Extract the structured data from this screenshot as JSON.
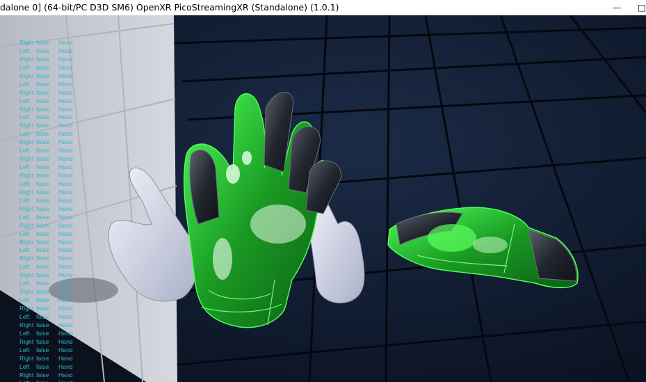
{
  "window": {
    "title": "dalone 0]  (64-bit/PC D3D SM6) OpenXR  PicoStreamingXR (Standalone) (1.0.1)",
    "minimize_glyph": "—",
    "maximize_glyph": "□"
  },
  "debug_log": [
    [
      "Right",
      "false",
      "Hand"
    ],
    [
      "Left",
      "false",
      "Hand"
    ],
    [
      "Right",
      "false",
      "Hand"
    ],
    [
      "Left",
      "false",
      "Hand"
    ],
    [
      "Right",
      "false",
      "Hand"
    ],
    [
      "Left",
      "false",
      "Hand"
    ],
    [
      "Right",
      "false",
      "Hand"
    ],
    [
      "Left",
      "false",
      "Hand"
    ],
    [
      "Right",
      "false",
      "Hand"
    ],
    [
      "Left",
      "false",
      "Hand"
    ],
    [
      "Right",
      "false",
      "Hand"
    ],
    [
      "Left",
      "false",
      "Hand"
    ],
    [
      "Right",
      "false",
      "Hand"
    ],
    [
      "Left",
      "false",
      "Hand"
    ],
    [
      "Right",
      "false",
      "Hand"
    ],
    [
      "Left",
      "false",
      "Hand"
    ],
    [
      "Right",
      "false",
      "Hand"
    ],
    [
      "Left",
      "false",
      "Hand"
    ],
    [
      "Right",
      "false",
      "Hand"
    ],
    [
      "Left",
      "false",
      "Hand"
    ],
    [
      "Right",
      "false",
      "Hand"
    ],
    [
      "Left",
      "false",
      "Hand"
    ],
    [
      "Right",
      "false",
      "Hand"
    ],
    [
      "Left",
      "false",
      "Hand"
    ],
    [
      "Right",
      "false",
      "Hand"
    ],
    [
      "Left",
      "false",
      "Hand"
    ],
    [
      "Right",
      "false",
      "Hand"
    ],
    [
      "Left",
      "false",
      "Hand"
    ],
    [
      "Right",
      "false",
      "Hand"
    ],
    [
      "Left",
      "false",
      "Hand"
    ],
    [
      "Right",
      "false",
      "Hand"
    ],
    [
      "Left",
      "false",
      "Hand"
    ],
    [
      "Right",
      "false",
      "Hand"
    ],
    [
      "Left",
      "false",
      "Hand"
    ],
    [
      "Right",
      "false",
      "Hand"
    ],
    [
      "Left",
      "false",
      "Hand"
    ],
    [
      "Right",
      "false",
      "Hand"
    ],
    [
      "Left",
      "false",
      "Hand"
    ],
    [
      "Right",
      "false",
      "Hand"
    ],
    [
      "Left",
      "false",
      "Hand"
    ],
    [
      "Right",
      "false",
      "Hand"
    ],
    [
      "Left",
      "false",
      "Hand"
    ],
    [
      "Right",
      "false",
      "Hand"
    ]
  ],
  "colors": {
    "debug_text": "#31b7cf",
    "floor": "#0c1424",
    "grid_line": "#000000",
    "wall": "#c9ccd3",
    "hand_white": "#e4e7f2",
    "glove_green": "#1fd82c",
    "carbon": "#262a33"
  }
}
